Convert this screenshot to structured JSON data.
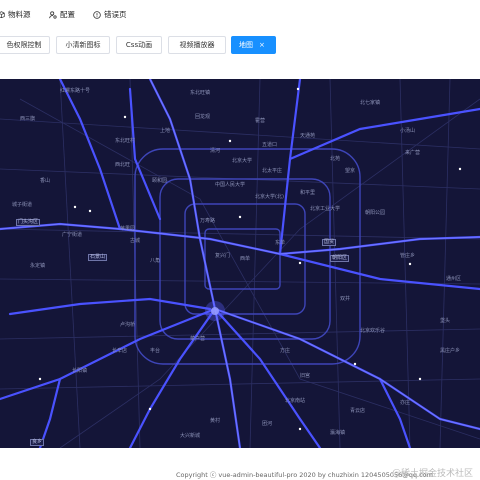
{
  "nav": {
    "items": [
      {
        "label": "物料源",
        "icon": "box-icon"
      },
      {
        "label": "配置",
        "icon": "user-gear-icon"
      },
      {
        "label": "错误页",
        "icon": "warning-circle-icon"
      }
    ]
  },
  "tags": [
    {
      "label": "色权限控制"
    },
    {
      "label": "小清新图标"
    },
    {
      "label": "Css动画"
    },
    {
      "label": "视频播放器"
    },
    {
      "label": "地图",
      "close": "×",
      "active": true
    }
  ],
  "map": {
    "labels": [
      "红螺东路十号",
      "东北旺镇",
      "西三旗",
      "回龙观",
      "霍营",
      "北七家镇",
      "天通苑",
      "东北旺村",
      "上地",
      "小汤山",
      "清河",
      "北苑",
      "来广营",
      "望京",
      "西北旺",
      "颐和园",
      "北京大学",
      "五道口",
      "中国人民大学",
      "北太平庄",
      "北京大学(北)",
      "和平里",
      "北京工业大学",
      "朝阳公园",
      "香山",
      "石景山",
      "城子街道",
      "门头沟区",
      "广宁街道",
      "古城",
      "八角",
      "万寿路",
      "复兴门",
      "西单",
      "东单",
      "国贸",
      "管庄乡",
      "苹果园",
      "永定镇",
      "长辛店",
      "丰台",
      "卢沟桥",
      "菜户营",
      "北京南站",
      "方庄",
      "双井",
      "垡头",
      "黑庄户乡",
      "北京欢乐谷",
      "亦庄",
      "良乡",
      "长阳镇",
      "青云店",
      "旧宫",
      "团河",
      "瀛海镇",
      "大兴新城",
      "黄村",
      "朝阳区",
      "通州区"
    ]
  },
  "footer": {
    "copyright": "Copyright ⓒ vue-admin-beautiful-pro 2020 by chuzhixin 1204505056@qq.com",
    "watermark": "@稀土掘金技术社区"
  }
}
